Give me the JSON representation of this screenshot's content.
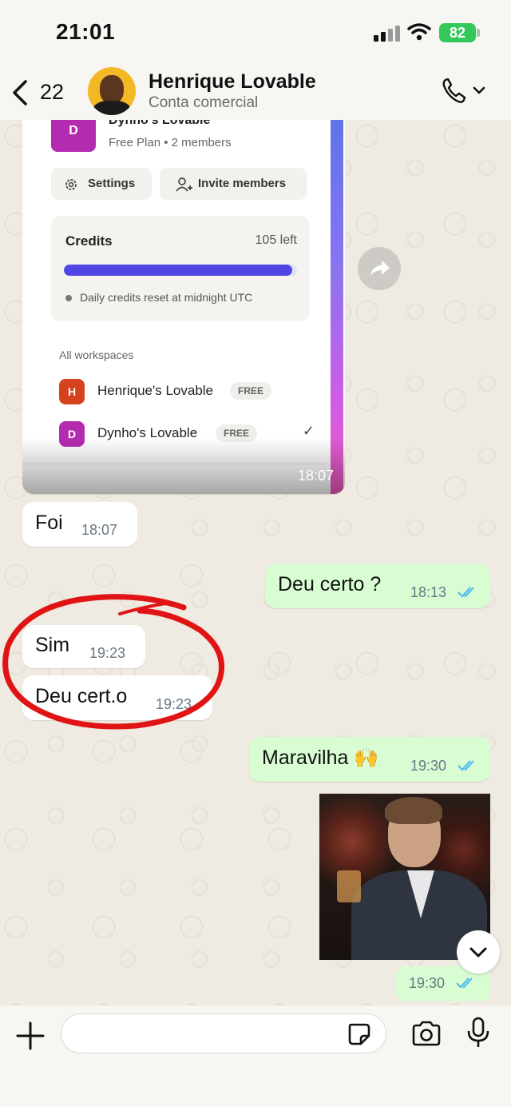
{
  "status_bar": {
    "time": "21:01",
    "battery": "82"
  },
  "header": {
    "back_count": "22",
    "contact_name": "Henrique Lovable",
    "contact_subtitle": "Conta comercial"
  },
  "screenshot": {
    "workspace_badge": "D",
    "workspace_title": "Dynho's Lovable",
    "plan": "Free Plan • 2 members",
    "settings_label": "Settings",
    "invite_label": "Invite members",
    "credits_title": "Credits",
    "credits_left": "105 left",
    "credits_fraction": 0.98,
    "credits_note": "Daily credits reset at midnight UTC",
    "all_workspaces": "All workspaces",
    "workspaces": [
      {
        "badge": "H",
        "name": "Henrique's Lovable",
        "tag": "FREE",
        "color": "#d4431e"
      },
      {
        "badge": "D",
        "name": "Dynho's Lovable",
        "tag": "FREE",
        "color": "#b32cb0"
      }
    ],
    "time": "18:07"
  },
  "messages": [
    {
      "dir": "in",
      "text": "Foi",
      "time": "18:07"
    },
    {
      "dir": "out",
      "text": "Deu certo ?",
      "time": "18:13"
    },
    {
      "dir": "in",
      "text": "Sim",
      "time": "19:23"
    },
    {
      "dir": "in",
      "text": "Deu cert.o",
      "time": "19:23"
    },
    {
      "dir": "out",
      "text": "Maravilha 🙌",
      "time": "19:30"
    },
    {
      "dir": "out",
      "text": "",
      "time": "19:30"
    }
  ],
  "colors": {
    "outgoing_bubble": "#d9fdd3",
    "incoming_bubble": "#ffffff",
    "read_ticks": "#53bdeb",
    "annotation_red": "#e01414"
  }
}
